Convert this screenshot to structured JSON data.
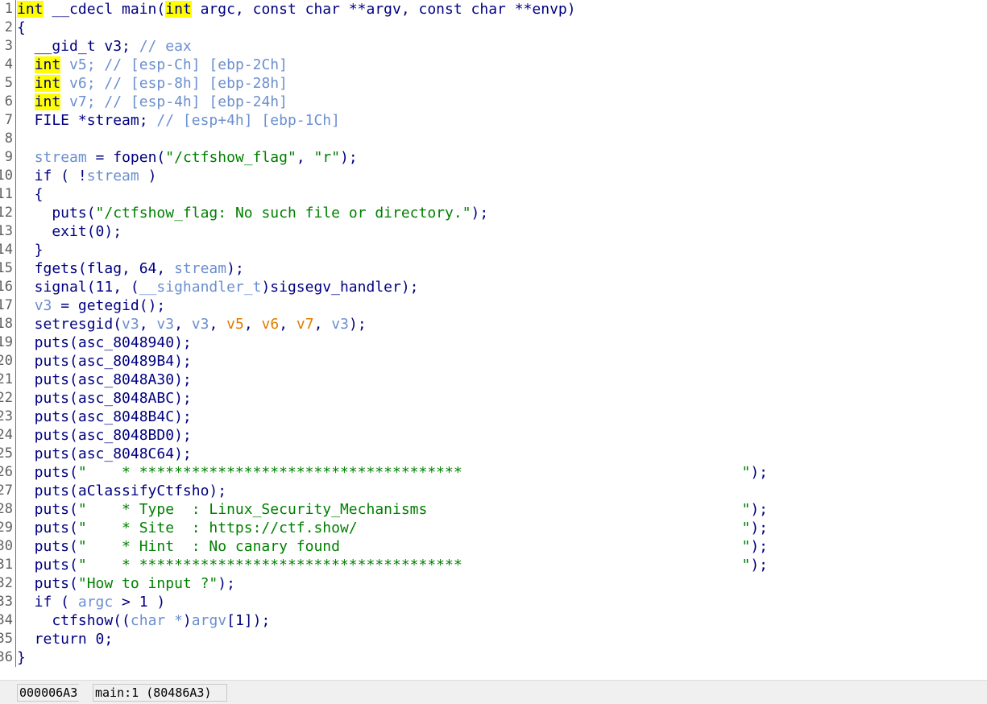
{
  "line_numbers": [
    "1",
    "2",
    "3",
    "4",
    "5",
    "6",
    "7",
    "8",
    "9",
    "10",
    "11",
    "12",
    "13",
    "14",
    "15",
    "16",
    "17",
    "18",
    "19",
    "20",
    "21",
    "22",
    "23",
    "24",
    "25",
    "26",
    "27",
    "28",
    "29",
    "30",
    "31",
    "32",
    "33",
    "34",
    "35",
    "36"
  ],
  "code": {
    "l1": {
      "kw1": "int",
      "decl": " __cdecl main(",
      "kw2": "int",
      "rest": " argc, const char **argv, const char **envp)"
    },
    "l2": "{",
    "l3": {
      "text": "  __gid_t v3; ",
      "comment": "// eax"
    },
    "l4": {
      "kw": "int",
      "var": " v5; ",
      "comment": "// [esp-Ch] [ebp-2Ch]"
    },
    "l5": {
      "kw": "int",
      "var": " v6; ",
      "comment": "// [esp-8h] [ebp-28h]"
    },
    "l6": {
      "kw": "int",
      "var": " v7; ",
      "comment": "// [esp-4h] [ebp-24h]"
    },
    "l7": {
      "text": "  FILE *stream; ",
      "comment": "// [esp+4h] [ebp-1Ch]"
    },
    "l8": "",
    "l9": {
      "var": "stream",
      "mid": " = fopen(",
      "s1": "\"/ctfshow_flag\"",
      "sep": ", ",
      "s2": "\"r\"",
      "end": ");"
    },
    "l10": {
      "pre": "  if ( !",
      "var": "stream",
      "end": " )"
    },
    "l11": "  {",
    "l12": {
      "pre": "    puts(",
      "str": "\"/ctfshow_flag: No such file or directory.\"",
      "end": ");"
    },
    "l13": "    exit(0);",
    "l14": "  }",
    "l15": {
      "pre": "  fgets(flag, 64, ",
      "var": "stream",
      "end": ");"
    },
    "l16": {
      "pre": "  signal(11, (",
      "type": "__sighandler_t",
      "end": ")sigsegv_handler);"
    },
    "l17": {
      "var": "v3",
      "end": " = getegid();"
    },
    "l18": {
      "pre": "  setresgid(",
      "a1": "v3",
      "c1": ", ",
      "a2": "v3",
      "c2": ", ",
      "a3": "v3",
      "c3": ", ",
      "a4": "v5",
      "c4": ", ",
      "a5": "v6",
      "c5": ", ",
      "a6": "v7",
      "c6": ", ",
      "a7": "v3",
      "end": ");"
    },
    "l19": "  puts(asc_8048940);",
    "l20": "  puts(asc_80489B4);",
    "l21": "  puts(asc_8048A30);",
    "l22": "  puts(asc_8048ABC);",
    "l23": "  puts(asc_8048B4C);",
    "l24": "  puts(asc_8048BD0);",
    "l25": "  puts(asc_8048C64);",
    "l26": {
      "pre": "  puts(",
      "str": "\"    * *************************************                                \"",
      "end": ");"
    },
    "l27": "  puts(aClassifyCtfsho);",
    "l28": {
      "pre": "  puts(",
      "str": "\"    * Type  : Linux_Security_Mechanisms                                    \"",
      "end": ");"
    },
    "l29": {
      "pre": "  puts(",
      "str": "\"    * Site  : https://ctf.show/                                            \"",
      "end": ");"
    },
    "l30": {
      "pre": "  puts(",
      "str": "\"    * Hint  : No canary found                                              \"",
      "end": ");"
    },
    "l31": {
      "pre": "  puts(",
      "str": "\"    * *************************************                                \"",
      "end": ");"
    },
    "l32": {
      "pre": "  puts(",
      "str": "\"How to input ?\"",
      "end": ");"
    },
    "l33": {
      "pre": "  if ( ",
      "var": "argc",
      "mid": " > 1 )"
    },
    "l34": {
      "pre": "    ctfshow((",
      "type": "char *",
      "mid": ")",
      "var": "argv",
      "end": "[1]);"
    },
    "l35": "  return 0;",
    "l36": "}"
  },
  "status_bar": {
    "address": "000006A3",
    "location": "main:1 (80486A3)"
  }
}
